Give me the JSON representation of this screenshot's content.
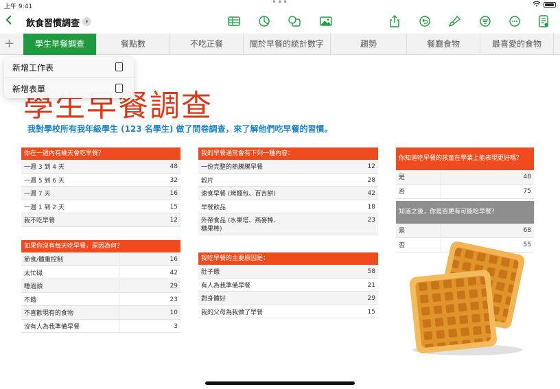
{
  "status": {
    "time": "上午 9:41"
  },
  "toolbar": {
    "title": "飲食習慣調查",
    "icons": [
      "back-chevron-icon",
      "table-icon",
      "chart-icon",
      "shapes-icon",
      "media-icon",
      "share-icon",
      "undo-icon",
      "paintbrush-icon",
      "format-icon",
      "more-icon",
      "document-icon"
    ]
  },
  "tabs": {
    "plus": "+",
    "items": [
      "學生早餐調查",
      "餐點數",
      "不吃正餐",
      "關於早餐的統計數字",
      "趨勢",
      "餐廳食物",
      "最喜愛的食物"
    ]
  },
  "popover": {
    "items": [
      "新增工作表",
      "新增表單"
    ]
  },
  "sheet": {
    "title": "學生早餐調查",
    "subtitle": "我對學校所有我年級學生 (123 名學生) 做了問卷調查，來了解他們吃早餐的習慣。"
  },
  "tables": {
    "t1": {
      "header": "你在一週內有幾天會吃早餐？",
      "rows": [
        {
          "k": "一週 3 到 4 天",
          "v": "48"
        },
        {
          "k": "一週 5 到 6 天",
          "v": "32"
        },
        {
          "k": "一週 7 天",
          "v": "16"
        },
        {
          "k": "一週 1 到 2 天",
          "v": "15"
        },
        {
          "k": "我不吃早餐",
          "v": "12"
        }
      ]
    },
    "t2": {
      "header": "如果你沒有每天吃早餐，原因為何？",
      "rows": [
        {
          "k": "節食/體重控制",
          "v": "16"
        },
        {
          "k": "太忙碌",
          "v": "42"
        },
        {
          "k": "睡過頭",
          "v": "29"
        },
        {
          "k": "不餓",
          "v": "23"
        },
        {
          "k": "不喜歡現有的食物",
          "v": "10"
        },
        {
          "k": "沒有人為我準備早餐",
          "v": "3"
        }
      ]
    },
    "t3": {
      "header": "我的早餐通常會有下列一種內容：",
      "rows": [
        {
          "k": "一份完整的熱騰騰早餐",
          "v": "12"
        },
        {
          "k": "穀片",
          "v": "28"
        },
        {
          "k": "速食早餐 (烤麵包、百吉餅)",
          "v": "42"
        },
        {
          "k": "早餐飲品",
          "v": "18"
        },
        {
          "k": "外帶食品 (水果塔、燕麥棒、",
          "k2": "糖果棒)",
          "v": "23"
        }
      ]
    },
    "t4": {
      "header": "我吃早餐的主要原因是：",
      "rows": [
        {
          "k": "肚子餓",
          "v": "58"
        },
        {
          "k": "有人為我準備早餐",
          "v": "21"
        },
        {
          "k": "對身體好",
          "v": "29"
        },
        {
          "k": "我的父母為我做了早餐",
          "v": "15"
        }
      ]
    },
    "t5": {
      "header": "你知道吃早餐的孩童在學業上能表現更好嗎？",
      "rows": [
        {
          "k": "是",
          "v": "48"
        },
        {
          "k": "否",
          "v": "75"
        }
      ]
    },
    "t6": {
      "header": "知道之後，你是否更有可能吃早餐？",
      "rows": [
        {
          "k": "是",
          "v": "68"
        },
        {
          "k": "否",
          "v": "55"
        }
      ]
    }
  },
  "colors": {
    "accent": "#1e9b3e",
    "header": "#f04b1e",
    "title": "#d93a1a",
    "subtitle": "#1d82c3"
  }
}
